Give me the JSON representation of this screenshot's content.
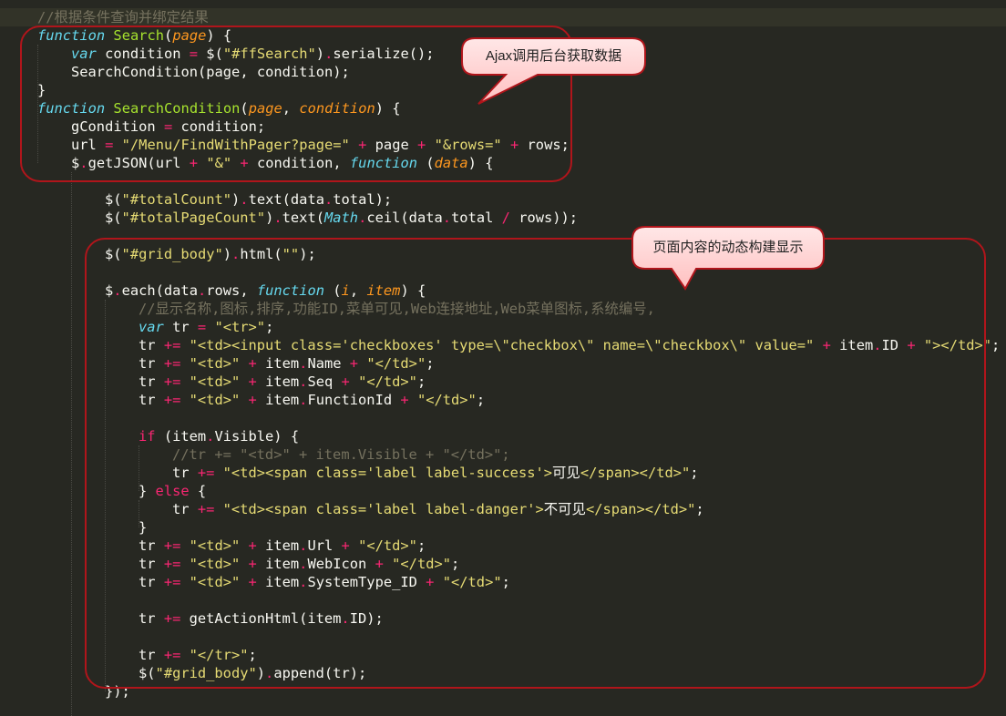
{
  "editor": {
    "lines": [
      {
        "indent": 0,
        "tokens": [
          [
            "c",
            "//根据条件查询并绑定结果"
          ]
        ]
      },
      {
        "indent": 0,
        "tokens": [
          [
            "k",
            "function"
          ],
          [
            "t",
            " "
          ],
          [
            "n",
            "Search"
          ],
          [
            "t",
            "("
          ],
          [
            "p",
            "page"
          ],
          [
            "t",
            ") {"
          ]
        ]
      },
      {
        "indent": 1,
        "tokens": [
          [
            "k",
            "var"
          ],
          [
            "t",
            " condition "
          ],
          [
            "o",
            "="
          ],
          [
            "t",
            " $("
          ],
          [
            "s",
            "\"#ffSearch\""
          ],
          [
            "t",
            ")"
          ],
          [
            "o",
            "."
          ],
          [
            "t",
            "serialize();"
          ]
        ]
      },
      {
        "indent": 1,
        "tokens": [
          [
            "t",
            "SearchCondition(page, condition);"
          ]
        ]
      },
      {
        "indent": 0,
        "tokens": [
          [
            "t",
            "}"
          ]
        ]
      },
      {
        "indent": 0,
        "tokens": [
          [
            "k",
            "function"
          ],
          [
            "t",
            " "
          ],
          [
            "n",
            "SearchCondition"
          ],
          [
            "t",
            "("
          ],
          [
            "p",
            "page"
          ],
          [
            "t",
            ", "
          ],
          [
            "p",
            "condition"
          ],
          [
            "t",
            ") {"
          ]
        ]
      },
      {
        "indent": 1,
        "tokens": [
          [
            "t",
            "gCondition "
          ],
          [
            "o",
            "="
          ],
          [
            "t",
            " condition;"
          ]
        ]
      },
      {
        "indent": 1,
        "tokens": [
          [
            "t",
            "url "
          ],
          [
            "o",
            "="
          ],
          [
            "t",
            " "
          ],
          [
            "s",
            "\"/Menu/FindWithPager?page=\""
          ],
          [
            "t",
            " "
          ],
          [
            "o",
            "+"
          ],
          [
            "t",
            " page "
          ],
          [
            "o",
            "+"
          ],
          [
            "t",
            " "
          ],
          [
            "s",
            "\"&rows=\""
          ],
          [
            "t",
            " "
          ],
          [
            "o",
            "+"
          ],
          [
            "t",
            " rows;"
          ]
        ]
      },
      {
        "indent": 1,
        "tokens": [
          [
            "t",
            "$"
          ],
          [
            "o",
            "."
          ],
          [
            "t",
            "getJSON(url "
          ],
          [
            "o",
            "+"
          ],
          [
            "t",
            " "
          ],
          [
            "s",
            "\"&\""
          ],
          [
            "t",
            " "
          ],
          [
            "o",
            "+"
          ],
          [
            "t",
            " condition, "
          ],
          [
            "k",
            "function"
          ],
          [
            "t",
            " ("
          ],
          [
            "p",
            "data"
          ],
          [
            "t",
            ") {"
          ]
        ]
      },
      {
        "indent": 0,
        "tokens": []
      },
      {
        "indent": 2,
        "tokens": [
          [
            "t",
            "$("
          ],
          [
            "s",
            "\"#totalCount\""
          ],
          [
            "t",
            ")"
          ],
          [
            "o",
            "."
          ],
          [
            "t",
            "text(data"
          ],
          [
            "o",
            "."
          ],
          [
            "t",
            "total);"
          ]
        ]
      },
      {
        "indent": 2,
        "tokens": [
          [
            "t",
            "$("
          ],
          [
            "s",
            "\"#totalPageCount\""
          ],
          [
            "t",
            ")"
          ],
          [
            "o",
            "."
          ],
          [
            "t",
            "text("
          ],
          [
            "k",
            "Math"
          ],
          [
            "o",
            "."
          ],
          [
            "t",
            "ceil(data"
          ],
          [
            "o",
            "."
          ],
          [
            "t",
            "total "
          ],
          [
            "o",
            "/"
          ],
          [
            "t",
            " rows));"
          ]
        ]
      },
      {
        "indent": 0,
        "tokens": []
      },
      {
        "indent": 2,
        "tokens": [
          [
            "t",
            "$("
          ],
          [
            "s",
            "\"#grid_body\""
          ],
          [
            "t",
            ")"
          ],
          [
            "o",
            "."
          ],
          [
            "t",
            "html("
          ],
          [
            "s",
            "\"\""
          ],
          [
            "t",
            ");"
          ]
        ]
      },
      {
        "indent": 0,
        "tokens": []
      },
      {
        "indent": 2,
        "tokens": [
          [
            "t",
            "$"
          ],
          [
            "o",
            "."
          ],
          [
            "t",
            "each(data"
          ],
          [
            "o",
            "."
          ],
          [
            "t",
            "rows, "
          ],
          [
            "k",
            "function"
          ],
          [
            "t",
            " ("
          ],
          [
            "p",
            "i"
          ],
          [
            "t",
            ", "
          ],
          [
            "p",
            "item"
          ],
          [
            "t",
            ") {"
          ]
        ]
      },
      {
        "indent": 3,
        "tokens": [
          [
            "c",
            "//显示名称,图标,排序,功能ID,菜单可见,Web连接地址,Web菜单图标,系统编号,"
          ]
        ]
      },
      {
        "indent": 3,
        "tokens": [
          [
            "k",
            "var"
          ],
          [
            "t",
            " tr "
          ],
          [
            "o",
            "="
          ],
          [
            "t",
            " "
          ],
          [
            "s",
            "\"<tr>\""
          ],
          [
            "t",
            ";"
          ]
        ]
      },
      {
        "indent": 3,
        "tokens": [
          [
            "t",
            "tr "
          ],
          [
            "o",
            "+="
          ],
          [
            "t",
            " "
          ],
          [
            "s",
            "\"<td><input class='checkboxes' type=\\\"checkbox\\\" name=\\\"checkbox\\\" value=\""
          ],
          [
            "t",
            " "
          ],
          [
            "o",
            "+"
          ],
          [
            "t",
            " item"
          ],
          [
            "o",
            "."
          ],
          [
            "t",
            "ID "
          ],
          [
            "o",
            "+"
          ],
          [
            "t",
            " "
          ],
          [
            "s",
            "\"></td>\""
          ],
          [
            "t",
            ";"
          ]
        ]
      },
      {
        "indent": 3,
        "tokens": [
          [
            "t",
            "tr "
          ],
          [
            "o",
            "+="
          ],
          [
            "t",
            " "
          ],
          [
            "s",
            "\"<td>\""
          ],
          [
            "t",
            " "
          ],
          [
            "o",
            "+"
          ],
          [
            "t",
            " item"
          ],
          [
            "o",
            "."
          ],
          [
            "t",
            "Name "
          ],
          [
            "o",
            "+"
          ],
          [
            "t",
            " "
          ],
          [
            "s",
            "\"</td>\""
          ],
          [
            "t",
            ";"
          ]
        ]
      },
      {
        "indent": 3,
        "tokens": [
          [
            "t",
            "tr "
          ],
          [
            "o",
            "+="
          ],
          [
            "t",
            " "
          ],
          [
            "s",
            "\"<td>\""
          ],
          [
            "t",
            " "
          ],
          [
            "o",
            "+"
          ],
          [
            "t",
            " item"
          ],
          [
            "o",
            "."
          ],
          [
            "t",
            "Seq "
          ],
          [
            "o",
            "+"
          ],
          [
            "t",
            " "
          ],
          [
            "s",
            "\"</td>\""
          ],
          [
            "t",
            ";"
          ]
        ]
      },
      {
        "indent": 3,
        "tokens": [
          [
            "t",
            "tr "
          ],
          [
            "o",
            "+="
          ],
          [
            "t",
            " "
          ],
          [
            "s",
            "\"<td>\""
          ],
          [
            "t",
            " "
          ],
          [
            "o",
            "+"
          ],
          [
            "t",
            " item"
          ],
          [
            "o",
            "."
          ],
          [
            "t",
            "FunctionId "
          ],
          [
            "o",
            "+"
          ],
          [
            "t",
            " "
          ],
          [
            "s",
            "\"</td>\""
          ],
          [
            "t",
            ";"
          ]
        ]
      },
      {
        "indent": 0,
        "tokens": []
      },
      {
        "indent": 3,
        "tokens": [
          [
            "o",
            "if"
          ],
          [
            "t",
            " (item"
          ],
          [
            "o",
            "."
          ],
          [
            "t",
            "Visible) {"
          ]
        ]
      },
      {
        "indent": 4,
        "tokens": [
          [
            "c",
            "//tr += \"<td>\" + item.Visible + \"</td>\";"
          ]
        ]
      },
      {
        "indent": 4,
        "tokens": [
          [
            "t",
            "tr "
          ],
          [
            "o",
            "+="
          ],
          [
            "t",
            " "
          ],
          [
            "s",
            "\"<td><span class='label label-success'>"
          ],
          [
            "t",
            "可见"
          ],
          [
            "s",
            "</span></td>\""
          ],
          [
            "t",
            ";"
          ]
        ]
      },
      {
        "indent": 3,
        "tokens": [
          [
            "t",
            "} "
          ],
          [
            "o",
            "else"
          ],
          [
            "t",
            " {"
          ]
        ]
      },
      {
        "indent": 4,
        "tokens": [
          [
            "t",
            "tr "
          ],
          [
            "o",
            "+="
          ],
          [
            "t",
            " "
          ],
          [
            "s",
            "\"<td><span class='label label-danger'>"
          ],
          [
            "t",
            "不可见"
          ],
          [
            "s",
            "</span></td>\""
          ],
          [
            "t",
            ";"
          ]
        ]
      },
      {
        "indent": 3,
        "tokens": [
          [
            "t",
            "}"
          ]
        ]
      },
      {
        "indent": 3,
        "tokens": [
          [
            "t",
            "tr "
          ],
          [
            "o",
            "+="
          ],
          [
            "t",
            " "
          ],
          [
            "s",
            "\"<td>\""
          ],
          [
            "t",
            " "
          ],
          [
            "o",
            "+"
          ],
          [
            "t",
            " item"
          ],
          [
            "o",
            "."
          ],
          [
            "t",
            "Url "
          ],
          [
            "o",
            "+"
          ],
          [
            "t",
            " "
          ],
          [
            "s",
            "\"</td>\""
          ],
          [
            "t",
            ";"
          ]
        ]
      },
      {
        "indent": 3,
        "tokens": [
          [
            "t",
            "tr "
          ],
          [
            "o",
            "+="
          ],
          [
            "t",
            " "
          ],
          [
            "s",
            "\"<td>\""
          ],
          [
            "t",
            " "
          ],
          [
            "o",
            "+"
          ],
          [
            "t",
            " item"
          ],
          [
            "o",
            "."
          ],
          [
            "t",
            "WebIcon "
          ],
          [
            "o",
            "+"
          ],
          [
            "t",
            " "
          ],
          [
            "s",
            "\"</td>\""
          ],
          [
            "t",
            ";"
          ]
        ]
      },
      {
        "indent": 3,
        "tokens": [
          [
            "t",
            "tr "
          ],
          [
            "o",
            "+="
          ],
          [
            "t",
            " "
          ],
          [
            "s",
            "\"<td>\""
          ],
          [
            "t",
            " "
          ],
          [
            "o",
            "+"
          ],
          [
            "t",
            " item"
          ],
          [
            "o",
            "."
          ],
          [
            "t",
            "SystemType_ID "
          ],
          [
            "o",
            "+"
          ],
          [
            "t",
            " "
          ],
          [
            "s",
            "\"</td>\""
          ],
          [
            "t",
            ";"
          ]
        ]
      },
      {
        "indent": 0,
        "tokens": []
      },
      {
        "indent": 3,
        "tokens": [
          [
            "t",
            "tr "
          ],
          [
            "o",
            "+="
          ],
          [
            "t",
            " getActionHtml(item"
          ],
          [
            "o",
            "."
          ],
          [
            "t",
            "ID);"
          ]
        ]
      },
      {
        "indent": 0,
        "tokens": []
      },
      {
        "indent": 3,
        "tokens": [
          [
            "t",
            "tr "
          ],
          [
            "o",
            "+="
          ],
          [
            "t",
            " "
          ],
          [
            "s",
            "\"</tr>\""
          ],
          [
            "t",
            ";"
          ]
        ]
      },
      {
        "indent": 3,
        "tokens": [
          [
            "t",
            "$("
          ],
          [
            "s",
            "\"#grid_body\""
          ],
          [
            "t",
            ")"
          ],
          [
            "o",
            "."
          ],
          [
            "t",
            "append(tr);"
          ]
        ]
      },
      {
        "indent": 2,
        "tokens": [
          [
            "t",
            "});"
          ]
        ]
      }
    ]
  },
  "annotations": {
    "ajax_note": "Ajax调用后台获取数据",
    "render_note": "页面内容的动态构建显示"
  },
  "colors": {
    "background": "#272822",
    "comment": "#75715e",
    "keyword": "#66d9ef",
    "function_name": "#a6e22e",
    "parameter": "#fd971f",
    "string": "#e6db74",
    "operator": "#f92672",
    "highlight_box": "#b0151b",
    "callout_fill": "#ffd6d6"
  }
}
